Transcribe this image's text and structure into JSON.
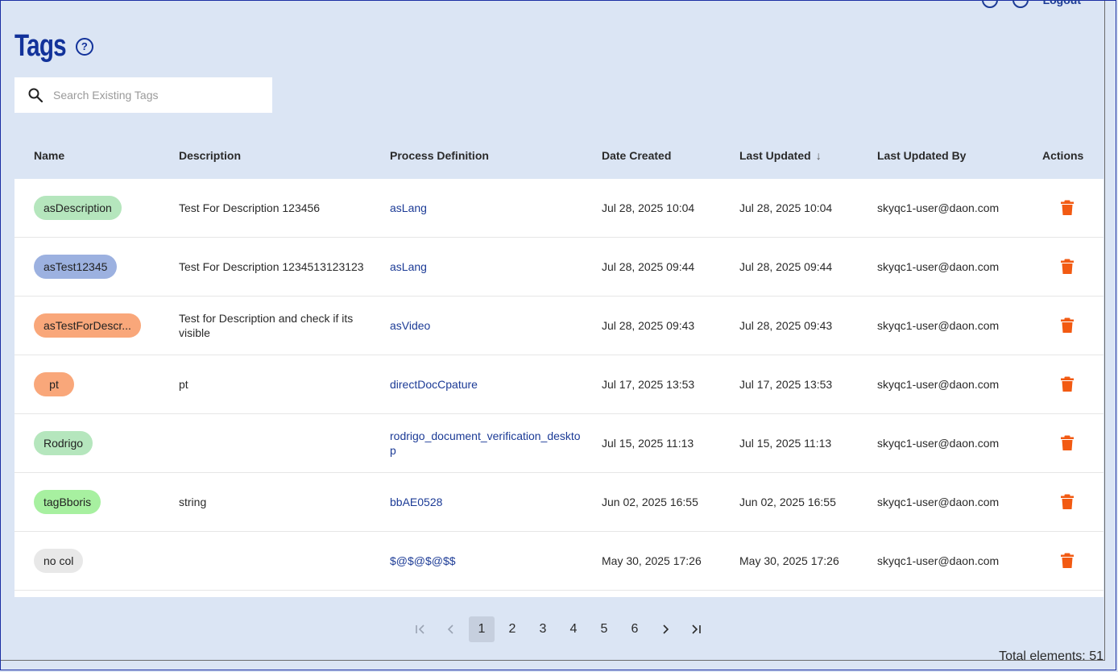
{
  "header": {
    "title": "Tags",
    "logout_label": "Logout"
  },
  "search": {
    "placeholder": "Search Existing Tags"
  },
  "columns": {
    "name": "Name",
    "description": "Description",
    "process_definition": "Process Definition",
    "date_created": "Date Created",
    "last_updated": "Last Updated",
    "last_updated_by": "Last Updated By",
    "actions": "Actions"
  },
  "rows": [
    {
      "name": "asDescription",
      "chip_color": "#b5e6bd",
      "description": "Test For Description 123456",
      "process": "asLang",
      "created": "Jul 28, 2025 10:04",
      "updated": "Jul 28, 2025 10:04",
      "by": "skyqc1-user@daon.com"
    },
    {
      "name": "asTest12345",
      "chip_color": "#9cb1e0",
      "description": "Test For Description 1234513123123",
      "process": "asLang",
      "created": "Jul 28, 2025 09:44",
      "updated": "Jul 28, 2025 09:44",
      "by": "skyqc1-user@daon.com"
    },
    {
      "name": "asTestForDescr...",
      "chip_color": "#f9a77a",
      "description": "Test for Description and check if its visible",
      "process": "asVideo",
      "created": "Jul 28, 2025 09:43",
      "updated": "Jul 28, 2025 09:43",
      "by": "skyqc1-user@daon.com"
    },
    {
      "name": "pt",
      "chip_color": "#f9a77a",
      "description": "pt",
      "process": "directDocCpature",
      "created": "Jul 17, 2025 13:53",
      "updated": "Jul 17, 2025 13:53",
      "by": "skyqc1-user@daon.com"
    },
    {
      "name": "Rodrigo",
      "chip_color": "#b5e6bd",
      "description": "",
      "process": "rodrigo_document_verification_desktop",
      "created": "Jul 15, 2025 11:13",
      "updated": "Jul 15, 2025 11:13",
      "by": "skyqc1-user@daon.com"
    },
    {
      "name": "tagBboris",
      "chip_color": "#a7f0a0",
      "description": "string",
      "process": "bbAE0528",
      "created": "Jun 02, 2025 16:55",
      "updated": "Jun 02, 2025 16:55",
      "by": "skyqc1-user@daon.com"
    },
    {
      "name": "no col",
      "chip_color": "#e8e8e8",
      "description": "",
      "process": "$@$@$@$$",
      "created": "May 30, 2025 17:26",
      "updated": "May 30, 2025 17:26",
      "by": "skyqc1-user@daon.com"
    }
  ],
  "pagination": {
    "pages": [
      "1",
      "2",
      "3",
      "4",
      "5",
      "6"
    ],
    "current": "1"
  },
  "total": "Total elements: 51",
  "colors": {
    "accent": "#12329a",
    "trash": "#f25a12",
    "background": "#dbe5f4"
  }
}
